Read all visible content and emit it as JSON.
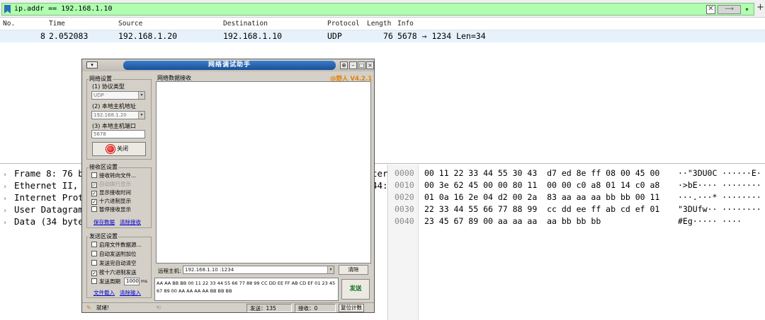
{
  "filter": {
    "text": "ip.addr == 192.168.1.10",
    "clear_glyph": "✕",
    "apply_glyph": "⟶",
    "dropdown_glyph": "▾",
    "add_glyph": "+"
  },
  "packet_list": {
    "columns": [
      "No.",
      "Time",
      "Source",
      "Destination",
      "Protocol",
      "Length",
      "Info"
    ],
    "rows": [
      {
        "no": "8",
        "time": "2.052083",
        "source": "192.168.1.20",
        "destination": "192.168.1.10",
        "protocol": "UDP",
        "length": "76",
        "info": "5678 → 1234 Len=34"
      }
    ]
  },
  "details": {
    "items": [
      {
        "label": "Frame 8: 76 by",
        "tail": "ter"
      },
      {
        "label": "Ethernet II, S",
        "tail": "44:"
      },
      {
        "label": "Internet Proto",
        "tail": ""
      },
      {
        "label": "User Datagram",
        "tail": ""
      },
      {
        "label": "Data (34 bytes",
        "tail": ""
      }
    ]
  },
  "hex": {
    "rows": [
      {
        "offset": "0000",
        "bytes": "00 11 22 33 44 55 30 43  d7 ed 8e ff 08 00 45 00",
        "ascii": "··\"3DU0C ······E·"
      },
      {
        "offset": "0010",
        "bytes": "00 3e 62 45 00 00 80 11  00 00 c0 a8 01 14 c0 a8",
        "ascii": "·>bE···· ········"
      },
      {
        "offset": "0020",
        "bytes": "01 0a 16 2e 04 d2 00 2a  83 aa aa aa bb bb 00 11",
        "ascii": "···.···* ········"
      },
      {
        "offset": "0030",
        "bytes": "22 33 44 55 66 77 88 99  cc dd ee ff ab cd ef 01",
        "ascii": "\"3DUfw·· ········"
      },
      {
        "offset": "0040",
        "bytes": "23 45 67 89 00 aa aa aa  aa bb bb bb",
        "ascii": "#Eg····· ····"
      }
    ]
  },
  "netassist": {
    "title": "网络调试助手",
    "brand": "@野人 V4.2.1",
    "net_settings": {
      "group": "网络设置",
      "protocol_label": "(1) 协议类型",
      "protocol_value": "UDP",
      "host_label": "(2) 本地主机地址",
      "host_value": "192.168.1.20",
      "port_label": "(3) 本地主机端口",
      "port_value": "5678",
      "close_button": "关闭"
    },
    "recv_settings": {
      "group": "接收区设置",
      "options": [
        {
          "label": "接收转向文件...",
          "checked": false,
          "disabled": false
        },
        {
          "label": "自动换行显示",
          "checked": true,
          "disabled": true
        },
        {
          "label": "显示接收时间",
          "checked": true,
          "disabled": false
        },
        {
          "label": "十六进制显示",
          "checked": true,
          "disabled": false
        },
        {
          "label": "暂停接收显示",
          "checked": false,
          "disabled": false
        }
      ],
      "save_link": "保存数据",
      "clear_link": "清除接收"
    },
    "send_settings": {
      "group": "发送区设置",
      "options": [
        {
          "label": "启用文件数据源...",
          "checked": false
        },
        {
          "label": "自动发送附加位",
          "checked": false
        },
        {
          "label": "发送完自动清空",
          "checked": false
        },
        {
          "label": "按十六进制发送",
          "checked": true
        }
      ],
      "period_label": "发送周期",
      "period_value": "1000",
      "period_unit": "ms",
      "load_link": "文件载入",
      "clear_link": "清除输入"
    },
    "recv_area_label": "网络数据接收",
    "remote_label": "远程主机:",
    "remote_value": "192.168.1.10 :1234",
    "clear_button": "清除",
    "send_text": "AA AA BB BB 00 11 22 33 44 55 66 77 88 99 CC DD EE FF AB CD EF 01 23 45 67 89 00 AA AA AA AA BB BB BB",
    "send_button": "发送",
    "status": {
      "ready": "就绪!",
      "sent": "发送：135",
      "received": "接收：0",
      "reset_button": "复位计数"
    }
  }
}
